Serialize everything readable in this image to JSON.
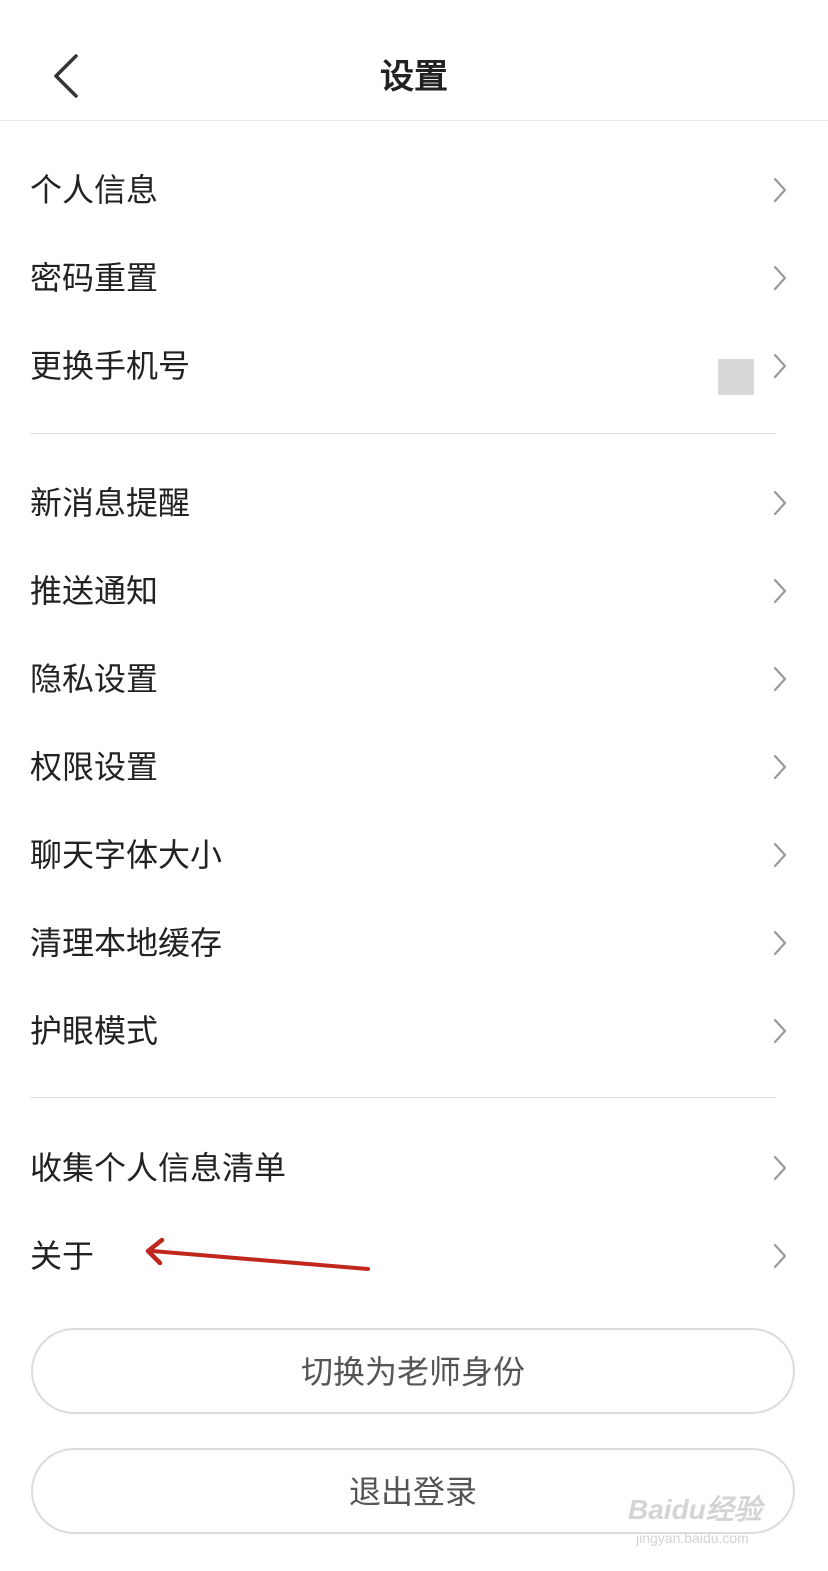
{
  "header": {
    "title": "设置",
    "back_icon": "chevron-left-icon"
  },
  "groups": [
    {
      "items": [
        {
          "label": "个人信息"
        },
        {
          "label": "密码重置"
        },
        {
          "label": "更换手机号"
        }
      ]
    },
    {
      "items": [
        {
          "label": "新消息提醒"
        },
        {
          "label": "推送通知"
        },
        {
          "label": "隐私设置"
        },
        {
          "label": "权限设置"
        },
        {
          "label": "聊天字体大小"
        },
        {
          "label": "清理本地缓存"
        },
        {
          "label": "护眼模式"
        }
      ]
    },
    {
      "items": [
        {
          "label": "收集个人信息清单"
        },
        {
          "label": "关于"
        }
      ]
    }
  ],
  "buttons": {
    "switch_role_label": "切换为老师身份",
    "logout_label": "退出登录"
  },
  "annotation": {
    "arrow_color": "#c0261c"
  },
  "watermark": {
    "brand": "Baidu经验",
    "url": "jingyan.baidu.com"
  },
  "colors": {
    "background": "#ffffff",
    "text": "#222222",
    "chevron": "#9a9a9a",
    "divider": "#e3e3e3",
    "button_border": "#dcdcdc",
    "button_text": "#555555"
  }
}
